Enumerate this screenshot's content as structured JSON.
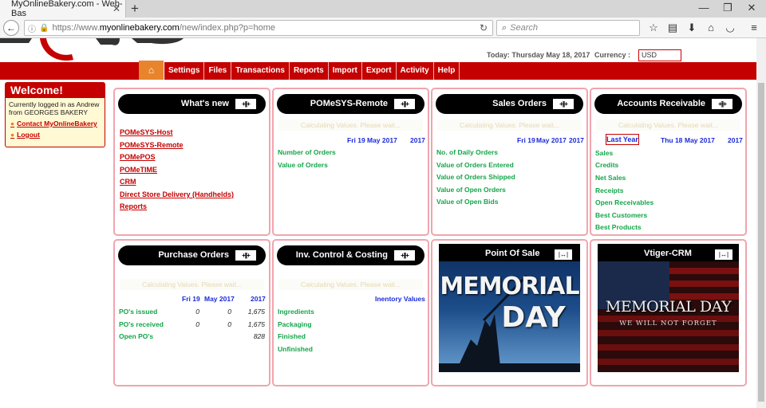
{
  "browser": {
    "tab_title": "MyOnlineBakery.com - Web-Bas",
    "url_scheme": "https://www.",
    "url_host": "myonlinebakery.com",
    "url_path": "/new/index.php?p=home",
    "search_placeholder": "Search"
  },
  "header": {
    "today": "Today: Thursday May 18, 2017",
    "currency_label": "Currency :",
    "currency_value": "USD"
  },
  "menu": [
    "Settings",
    "Files",
    "Transactions",
    "Reports",
    "Import",
    "Export",
    "Activity",
    "Help"
  ],
  "welcome": {
    "title": "Welcome!",
    "text": "Currently logged in as Andrew from GEORGES BAKERY",
    "contact": "Contact MyOnlineBakery",
    "logout": "Logout"
  },
  "calc_text": "Calculating Values. Please wait...",
  "whats_new": {
    "title": "What's new",
    "links": [
      "POMeSYS-Host",
      "POMeSYS-Remote",
      "POMePOS",
      "POMeTIME",
      "CRM",
      "Direct Store Delivery (Handhelds)",
      "Reports"
    ]
  },
  "pomesys": {
    "title": "POMeSYS-Remote",
    "date1": "Fri 19",
    "month": "May 2017",
    "year": "2017",
    "rows": [
      "Number of Orders",
      "Value of Orders"
    ]
  },
  "sales_orders": {
    "title": "Sales Orders",
    "date1": "Fri 19",
    "month": "May 2017",
    "year": "2017",
    "rows": [
      "No. of Daily Orders",
      "Value of Orders Entered",
      "Value of Orders Shipped",
      "Value of Open Orders",
      "Value of Open Bids"
    ]
  },
  "ar": {
    "title": "Accounts Receivable",
    "last_year": "Last Year",
    "date1": "Thu 18",
    "month": "May 2017",
    "year": "2017",
    "rows": [
      "Sales",
      "Credits",
      "Net Sales",
      "Receipts",
      "Open Receivables",
      "Best Customers",
      "Best Products"
    ]
  },
  "purchase_orders": {
    "title": "Purchase Orders",
    "date1": "Fri 19",
    "month": "May 2017",
    "year": "2017",
    "rows": [
      {
        "label": "PO's issued",
        "a": "0",
        "b": "0",
        "c": "1,675"
      },
      {
        "label": "PO's received",
        "a": "0",
        "b": "0",
        "c": "1,675"
      },
      {
        "label": "Open PO's",
        "a": "",
        "b": "",
        "c": "828"
      }
    ]
  },
  "inventory": {
    "title": "Inv. Control & Costing",
    "header": "Inentory Values",
    "rows": [
      "Ingredients",
      "Packaging",
      "Finished",
      "Unfinished"
    ]
  },
  "pos": {
    "title": "Point Of Sale",
    "poster_line1": "MEMORIAL",
    "poster_line2": "DAY"
  },
  "crm": {
    "title": "Vtiger-CRM",
    "poster_line1": "MEMORIAL DAY",
    "poster_line2": "WE WILL NOT FORGET"
  },
  "toggle_glyph": "+||+",
  "expand_glyph": "|↔|",
  "colors": {
    "brand_red": "#c40000",
    "home_orange": "#e8842b",
    "green_label": "#15a54a",
    "blue_header": "#1a2ad8"
  }
}
